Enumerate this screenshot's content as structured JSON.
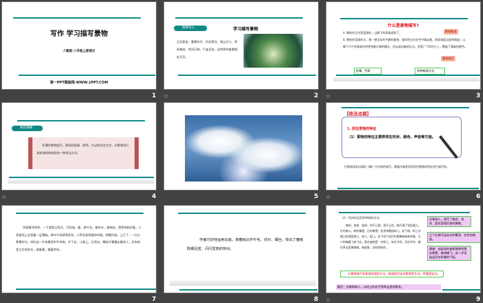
{
  "slides": [
    {
      "number": "1",
      "title": "写作 学习描写景物",
      "subtitle": "人教版·八年级上册语文",
      "footer": "第一PPT模板网-WWW.1PPT.COM"
    },
    {
      "number": "2",
      "badge": "情景导入",
      "title": "学习描写景物",
      "body": "日月星辰、春夏秋冬、风花雪月、高山大川、草原森林、世间万物，千姿百态，自然界的美景随处可见。"
    },
    {
      "number": "3",
      "title": "什么是景物描写?",
      "a": "A. 晚秋的天空是澄清的，山脚下的高粱成熟了。",
      "b": "B. 晚秋的澄清的天，像一望无际的平静的碧海；强烈的白光在空中跳动着，宛如海面泛起的微波；山脚下片片的高粱时时摇曳着丰满的穗头，好似波动着的红水。而宽广了的叶片上，覆盖了满坡的颜色。",
      "callout1": "景物叙述",
      "callout2": "景物描写",
      "tag1": "形象、色彩",
      "tag2": "多种修辞方法"
    },
    {
      "number": "4",
      "badge": "知识讲解",
      "body": "所谓的景物描写，是指用准确、鲜明、生动的语言文字，对景物进行具体描绘和刻画的一种表达方式。"
    },
    {
      "number": "5"
    },
    {
      "number": "6",
      "header": "【技法点拨】",
      "point": "1. 抓住景物的特征",
      "detail": "（1）景物的特征主要表现在形状、颜色、声音等方面。",
      "body": "仔细阅读朱自清的《春》中对雨的描写，看看作者是怎样抓住景物的特征进行描写的。"
    },
    {
      "number": "7",
      "body": "雨是最寻常的，一下就是三两天。可别恼。看，像牛毛，像花针，像细丝，密密地斜织着，人家屋顶上全笼着一层薄烟。树叶子却绿得发亮，小草也青得逼你的眼。傍晚时候，上灯了，一点点黄晕的光，烘托出一片安静而和平的夜。乡下去，小路上，石桥边，撑起伞慢慢走着的人；还有地里工作的农夫，披着蓑，戴着笠的。"
    },
    {
      "number": "8",
      "body": "作者巧妙地运用比喻，将春雨比作牛毛、花针、细丝，突出了春雨既细且密、闪闪发亮的特点。"
    },
    {
      "number": "9",
      "heading": "（2）巧妙的运用多种修辞方法",
      "body": "桃树、杏树、梨树，你不让我，我不让你，都开满了花赶趟儿。红的像火，粉的像霞，白的像雪。花里带着甜味儿；闭了眼，树上仿佛已经满是桃儿、杏儿、梨儿。花下成千成百的蜜蜂嗡嗡地闹着，大小的蝴蝶飞来飞去。野花遍地是：杂样儿，有名字的，没名字的，散在草丛里像眼睛，像星星，还眨呀眨的。",
      "note1": "比喻拟人，描写了桃花、杏花、梨花竞相开放的景象。",
      "note2": "三个比喻写出花朵的繁茂、花色的艳丽。",
      "note3": "想像：由梨花的香甜联想到果实累累，蜂闹蝶飞，进一步渲染出百花争春的气氛。",
      "summary": "对景物描写有意使用修辞方法，能使描写出的景物更生动，更富感染力。",
      "footer": "最后：比喻和拟人，从树上的花写到草丛里的野花。"
    }
  ],
  "animation_icon": "☆"
}
